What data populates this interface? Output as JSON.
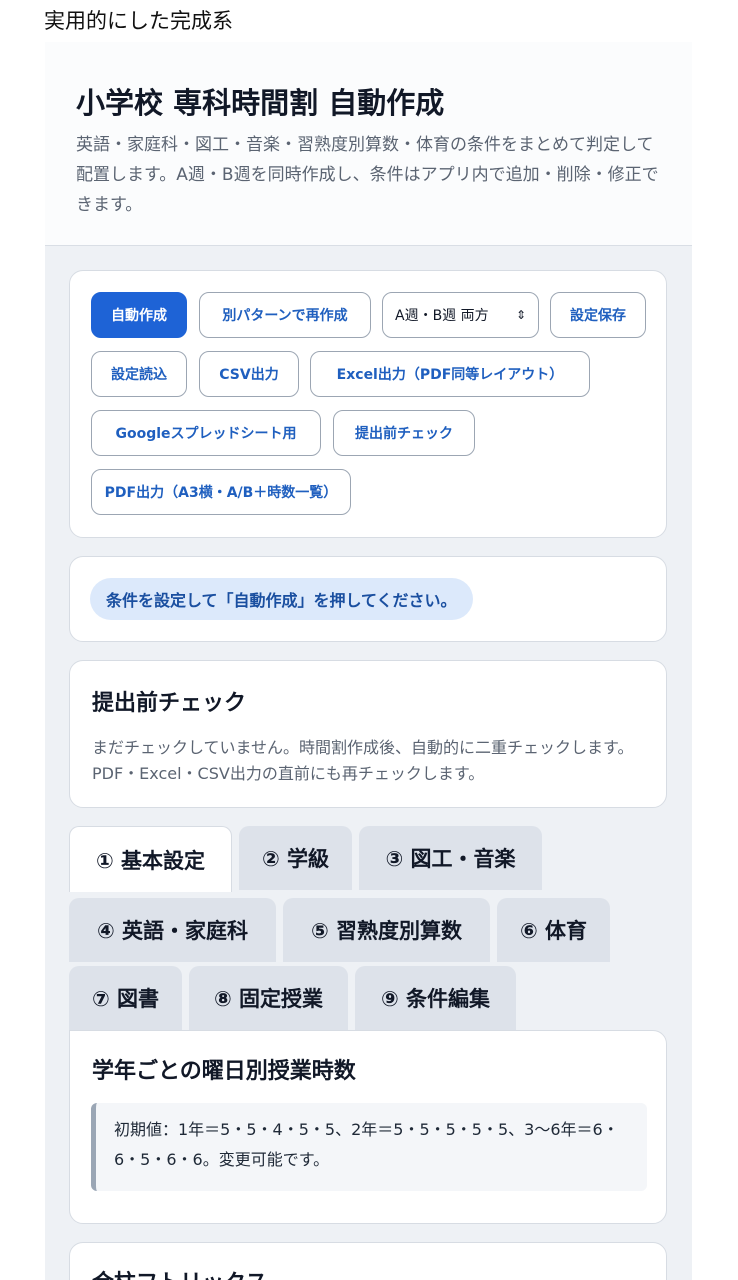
{
  "caption": "実用的にした完成系",
  "header": {
    "title": "小学校 専科時間割 自動作成",
    "description": "英語・家庭科・図工・音楽・習熟度別算数・体育の条件をまとめて判定して配置します。A週・B週を同時作成し、条件はアプリ内で追加・削除・修正できます。"
  },
  "toolbar": {
    "auto_create": "自動作成",
    "recreate_pattern": "別パターンで再作成",
    "week_select": "A週・B週 両方",
    "save_settings": "設定保存",
    "load_settings": "設定読込",
    "csv_export": "CSV出力",
    "excel_export": "Excel出力（PDF同等レイアウト）",
    "google_sheets": "Googleスプレッドシート用",
    "pre_check": "提出前チェック",
    "pdf_export": "PDF出力（A3横・A/B＋時数一覧）"
  },
  "status": {
    "message": "条件を設定して「自動作成」を押してください。"
  },
  "precheck": {
    "title": "提出前チェック",
    "description": "まだチェックしていません。時間割作成後、自動的に二重チェックします。PDF・Excel・CSV出力の直前にも再チェックします。"
  },
  "tabs": [
    {
      "label": "① 基本設定"
    },
    {
      "label": "② 学級"
    },
    {
      "label": "③ 図工・音楽"
    },
    {
      "label": "④ 英語・家庭科"
    },
    {
      "label": "⑤ 習熟度別算数"
    },
    {
      "label": "⑥ 体育"
    },
    {
      "label": "⑦ 図書"
    },
    {
      "label": "⑧ 固定授業"
    },
    {
      "label": "⑨ 条件編集"
    }
  ],
  "panel": {
    "title": "学年ごとの曜日別授業時数",
    "note": "初期値：1年＝5・5・4・5・5、2年＝5・5・5・5・5、3〜6年＝6・6・5・6・6。変更可能です。"
  },
  "next_section": {
    "title": "合柱フトリックス"
  }
}
